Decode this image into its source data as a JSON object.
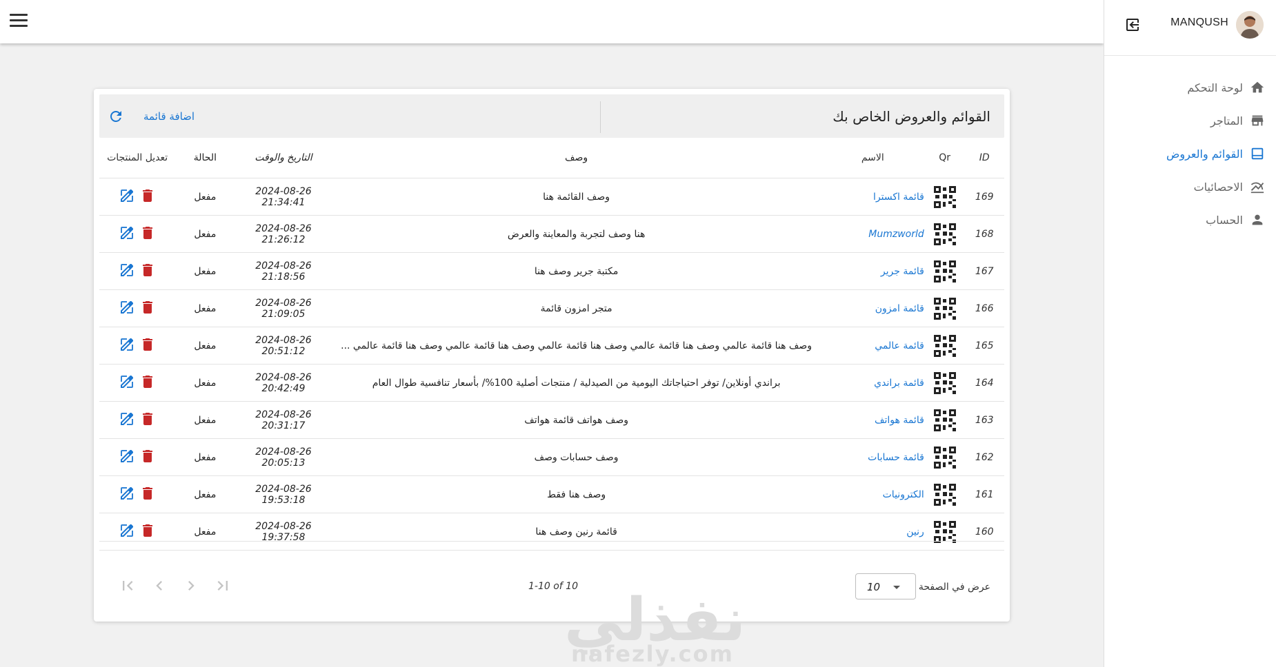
{
  "sidebar": {
    "username": "MANQUSH",
    "items": [
      {
        "label": "لوحة التحكم",
        "icon": "home-icon"
      },
      {
        "label": "المتاجر",
        "icon": "store-icon"
      },
      {
        "label": "القوائم والعروض",
        "icon": "list-icon",
        "active": true
      },
      {
        "label": "الاحصائيات",
        "icon": "chart-icon"
      },
      {
        "label": "الحساب",
        "icon": "person-icon"
      }
    ]
  },
  "card": {
    "title": "القوائم والعروض الخاص بك",
    "add_label": "اضافة قائمة",
    "columns": {
      "id": "ID",
      "qr": "Qr",
      "name": "الاسم",
      "desc": "وصف",
      "date": "التاريخ والوقت",
      "status": "الحالة",
      "actions": "تعديل المنتجات"
    },
    "rows": [
      {
        "id": "169",
        "name": "قائمة اكسترا",
        "desc": "وصف القائمة هنا",
        "date": "2024-08-26 21:34:41",
        "status": "مفعل"
      },
      {
        "id": "168",
        "name": "Mumzworld",
        "desc": "هنا وصف لتجربة والمعاينة والعرض",
        "date": "2024-08-26 21:26:12",
        "status": "مفعل"
      },
      {
        "id": "167",
        "name": "قائمة جرير",
        "desc": "مكتبة جرير وصف هنا",
        "date": "2024-08-26 21:18:56",
        "status": "مفعل"
      },
      {
        "id": "166",
        "name": "قائمة امزون",
        "desc": "متجر امزون قائمة",
        "date": "2024-08-26 21:09:05",
        "status": "مفعل"
      },
      {
        "id": "165",
        "name": "قائمة عالمي",
        "desc": "وصف هنا قائمة عالمي وصف هنا قائمة عالمي وصف هنا قائمة عالمي وصف هنا قائمة عالمي وصف هنا قائمة عالمي ...",
        "date": "2024-08-26 20:51:12",
        "status": "مفعل"
      },
      {
        "id": "164",
        "name": "قائمة براندي",
        "desc": "براندي أونلاين/ توفر احتياجاتك اليومية من الصيدلية / منتجات أصلية 100%/ بأسعار تنافسية طوال العام",
        "date": "2024-08-26 20:42:49",
        "status": "مفعل"
      },
      {
        "id": "163",
        "name": "قائمة هواتف",
        "desc": "وصف هواتف قائمة هواتف",
        "date": "2024-08-26 20:31:17",
        "status": "مفعل"
      },
      {
        "id": "162",
        "name": "قائمة حسابات",
        "desc": "وصف حسابات وصف",
        "date": "2024-08-26 20:05:13",
        "status": "مفعل"
      },
      {
        "id": "161",
        "name": "الكترونيات",
        "desc": "وصف هنا فقط",
        "date": "2024-08-26 19:53:18",
        "status": "مفعل"
      },
      {
        "id": "160",
        "name": "رنين",
        "desc": "قائمة رنين وصف هنا",
        "date": "2024-08-26 19:37:58",
        "status": "مفعل"
      }
    ]
  },
  "pagination": {
    "rows_label": "عرض في الصفحة",
    "rows_value": "10",
    "range": "1-10 of 10"
  },
  "watermark": {
    "text": "نفذلي",
    "sub": "nafezly.com"
  },
  "colors": {
    "accent": "#1976d2",
    "delete": "#c62828"
  }
}
